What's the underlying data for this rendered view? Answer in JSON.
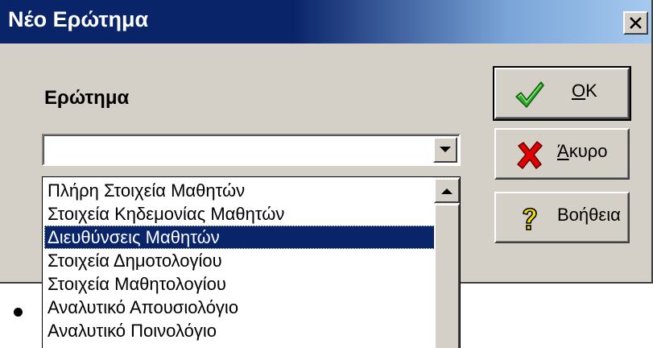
{
  "dialog": {
    "title": "Νέο Ερώτημα",
    "question_label": "Ερώτημα",
    "combo_value": ""
  },
  "buttons": {
    "ok": {
      "accel": "O",
      "rest": "K",
      "icon": "checkmark-icon"
    },
    "cancel": {
      "accel": "Ά",
      "rest": "κυρο",
      "icon": "red-x-icon"
    },
    "help": {
      "label": "Βοήθεια",
      "icon": "question-mark-icon"
    }
  },
  "dropdown": {
    "items": [
      "Πλήρη Στοιχεία Μαθητών",
      "Στοιχεία Κηδεμονίας Μαθητών",
      "Διευθύνσεις Μαθητών",
      "Στοιχεία Δημοτολογίου",
      "Στοιχεία Μαθητολογίου",
      "Αναλυτικό Απουσιολόγιο",
      "Αναλυτικό Ποινολόγιο"
    ],
    "selected_index": 2
  },
  "colors": {
    "titlebar_start": "#0a246a",
    "titlebar_end": "#a6caf0",
    "selection": "#0a246a",
    "dialog_face": "#d4d0c8"
  }
}
